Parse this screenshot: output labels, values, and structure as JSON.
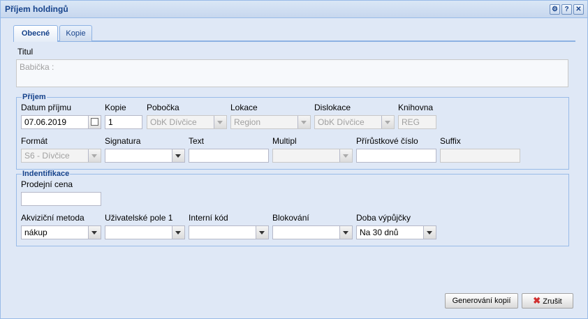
{
  "window": {
    "title": "Příjem holdingů",
    "tools": [
      "gear-icon",
      "help-icon",
      "close-icon"
    ],
    "help_glyph": "?",
    "close_glyph": "✕",
    "gear_glyph": "⚙"
  },
  "tabs": [
    {
      "label": "Obecné",
      "active": true
    },
    {
      "label": "Kopie",
      "active": false
    }
  ],
  "titul": {
    "label": "Titul",
    "value": "Babička :"
  },
  "prijem": {
    "legend": "Příjem",
    "datum_prijmu": {
      "label": "Datum příjmu",
      "value": "07.06.2019"
    },
    "kopie": {
      "label": "Kopie",
      "value": "1"
    },
    "pobocka": {
      "label": "Pobočka",
      "value": "ObK Dívčice"
    },
    "lokace": {
      "label": "Lokace",
      "value": "Region"
    },
    "dislokace": {
      "label": "Dislokace",
      "value": "ObK Dívčice"
    },
    "knihovna": {
      "label": "Knihovna",
      "value": "REG"
    },
    "format": {
      "label": "Formát",
      "value": "S6 - Dívčice"
    },
    "signatura": {
      "label": "Signatura",
      "value": ""
    },
    "text": {
      "label": "Text",
      "value": ""
    },
    "multipl": {
      "label": "Multipl",
      "value": ""
    },
    "prirustkove_cislo": {
      "label": "Přírůstkové číslo",
      "value": ""
    },
    "suffix": {
      "label": "Suffix",
      "value": ""
    }
  },
  "identifikace": {
    "legend": "Indentifikace",
    "prodejni_cena": {
      "label": "Prodejní cena",
      "value": ""
    },
    "akvizicni_metoda": {
      "label": "Akviziční metoda",
      "value": "nákup"
    },
    "uzivatelske_pole": {
      "label": "Uživatelské pole 1",
      "value": ""
    },
    "interni_kod": {
      "label": "Interní kód",
      "value": ""
    },
    "blokovani": {
      "label": "Blokování",
      "value": ""
    },
    "doba_vypujcky": {
      "label": "Doba výpůjčky",
      "value": "Na 30 dnů"
    }
  },
  "buttons": {
    "generate": "Generování kopií",
    "cancel": "Zrušit"
  },
  "colors": {
    "accent": "#15428b",
    "border": "#99bbe8",
    "background": "#dfe8f6",
    "cancel_icon": "#d03030"
  }
}
